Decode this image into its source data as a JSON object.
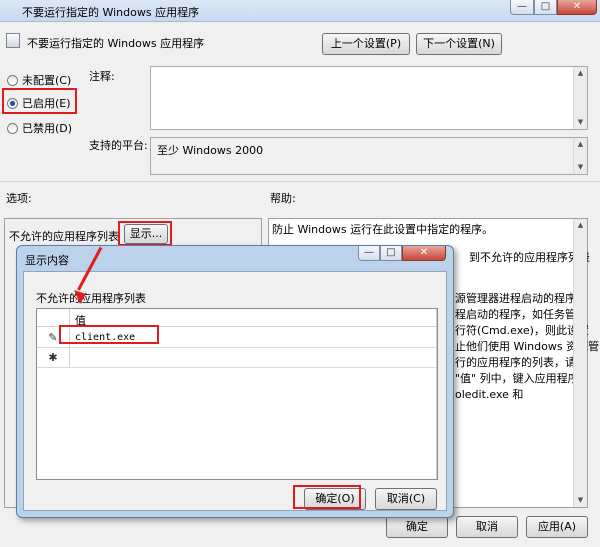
{
  "window": {
    "title": "不要运行指定的 Windows 应用程序",
    "policy_title": "不要运行指定的 Windows 应用程序",
    "min_glyph": "—",
    "max_glyph": "□",
    "close_glyph": "✕"
  },
  "nav": {
    "prev_label": "上一个设置(P)",
    "next_label": "下一个设置(N)"
  },
  "state": {
    "options": [
      {
        "label": "未配置(C)",
        "selected": false
      },
      {
        "label": "已启用(E)",
        "selected": true
      },
      {
        "label": "已禁用(D)",
        "selected": false
      }
    ]
  },
  "fields": {
    "comment_label": "注释:",
    "platform_label": "支持的平台:",
    "platform_value": "至少 Windows 2000"
  },
  "sections": {
    "options_label": "选项:",
    "help_label": "帮助:"
  },
  "options_panel": {
    "list_label": "不允许的应用程序列表",
    "show_button": "显示..."
  },
  "help": {
    "lines": [
      "防止 Windows 运行在此设置中指定的程序。",
      "到不允许的应用程序列表",
      "源管理器进程启动的程序。",
      "程启动的程序，如任务管",
      "行符(Cmd.exe)，则此设置",
      "止他们使用 Windows 资源管",
      "行的应用程序的列表，请单",
      "\"值\" 列中，键入应用程序",
      "oledit.exe 和"
    ]
  },
  "dialog": {
    "title": "显示内容",
    "list_title": "不允许的应用程序列表",
    "column_header": "值",
    "rows": [
      {
        "marker": "✎",
        "value": "client.exe"
      },
      {
        "marker": "✱",
        "value": ""
      }
    ],
    "ok_label": "确定(O)",
    "cancel_label": "取消(C)"
  },
  "footer": {
    "ok_label": "确定",
    "cancel_label": "取消",
    "apply_label": "应用(A)"
  },
  "colors": {
    "highlight": "#e21c1c",
    "dialog_frame": "#bcd1ea"
  }
}
